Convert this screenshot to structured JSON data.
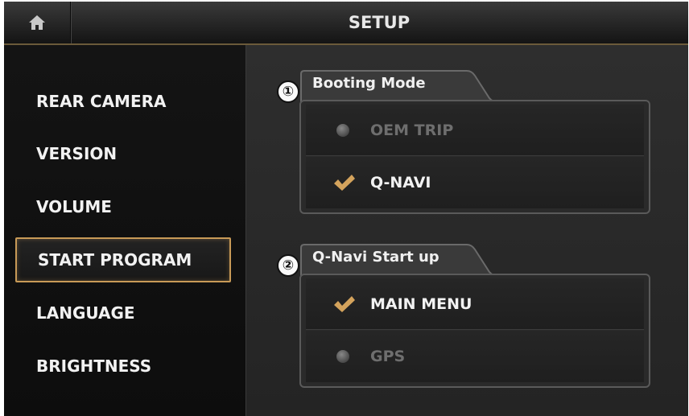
{
  "header": {
    "home_icon": "home-icon",
    "title": "SETUP"
  },
  "sidebar": {
    "items": [
      {
        "label": "REAR CAMERA",
        "active": false
      },
      {
        "label": "VERSION",
        "active": false
      },
      {
        "label": "VOLUME",
        "active": false
      },
      {
        "label": "START PROGRAM",
        "active": true
      },
      {
        "label": "LANGUAGE",
        "active": false
      },
      {
        "label": "BRIGHTNESS",
        "active": false
      }
    ]
  },
  "main": {
    "groups": [
      {
        "marker": "①",
        "title": "Booting Mode",
        "options": [
          {
            "label": "OEM TRIP",
            "selected": false,
            "icon": "radio-dot-icon"
          },
          {
            "label": "Q-NAVI",
            "selected": true,
            "icon": "check-icon"
          }
        ]
      },
      {
        "marker": "②",
        "title": "Q-Navi Start up",
        "options": [
          {
            "label": "MAIN MENU",
            "selected": true,
            "icon": "check-icon"
          },
          {
            "label": "GPS",
            "selected": false,
            "icon": "radio-dot-icon"
          }
        ]
      }
    ]
  },
  "colors": {
    "accent": "#c89a57",
    "background": "#1b1b1b",
    "text": "#f2f2f2",
    "disabled_text": "#6e6e6e"
  }
}
